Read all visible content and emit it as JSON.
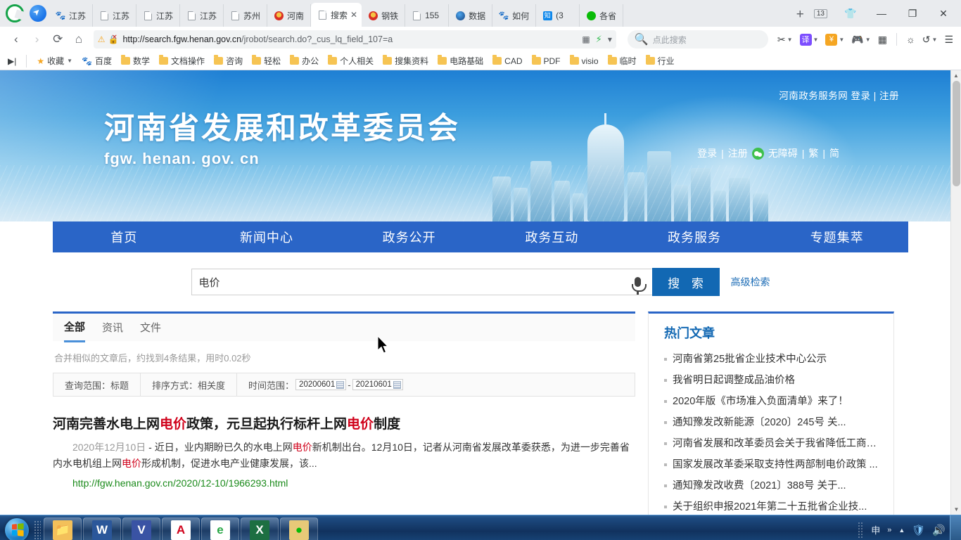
{
  "browser": {
    "tabs": [
      {
        "title": "江苏",
        "favicon": "baidu-icon",
        "active": false
      },
      {
        "title": "江苏",
        "favicon": "document-icon",
        "active": false
      },
      {
        "title": "江苏",
        "favicon": "document-icon",
        "active": false
      },
      {
        "title": "江苏",
        "favicon": "document-icon",
        "active": false
      },
      {
        "title": "苏州",
        "favicon": "document-icon",
        "active": false
      },
      {
        "title": "河南",
        "favicon": "gov-emblem-icon",
        "active": false
      },
      {
        "title": "搜索",
        "favicon": "document-icon",
        "active": true
      },
      {
        "title": "钢铁",
        "favicon": "gov-emblem-icon",
        "active": false
      },
      {
        "title": "155",
        "favicon": "document-icon",
        "active": false
      },
      {
        "title": "数据",
        "favicon": "globe-icon",
        "active": false
      },
      {
        "title": "如何",
        "favicon": "baidu-icon",
        "active": false
      },
      {
        "title": "(3 ",
        "favicon": "zhihu-icon",
        "active": false
      },
      {
        "title": "各省",
        "favicon": "wechat-icon",
        "active": false
      }
    ],
    "new_tab_label": "+",
    "window_badge": "13",
    "window_controls": {
      "minimize": "—",
      "maximize": "❐",
      "close": "✕"
    },
    "address": {
      "url_bold": "http://search.fgw.henan.gov.cn",
      "url_dim": "/jrobot/search.do?_cus_lq_field_107=a",
      "shield_icon": "warning-shield-icon",
      "lock_icon": "broken-lock-icon"
    },
    "toolbar_search_placeholder": "点此搜索",
    "nav": {
      "back": "‹",
      "forward": "›",
      "reload": "⟳",
      "home": "⌂"
    },
    "tools": [
      {
        "name": "screenshot-tool",
        "glyph": "✂",
        "color": "#3c4043"
      },
      {
        "name": "translate-tool",
        "glyph": "译",
        "color": "#7c4dff"
      },
      {
        "name": "coupon-tool",
        "glyph": "¥",
        "color": "#f5a623"
      },
      {
        "name": "game-tool",
        "glyph": "🎮",
        "color": "#ff5a36"
      },
      {
        "name": "apps-grid",
        "glyph": "▦",
        "color": "#3c4043"
      },
      {
        "name": "theme-tool",
        "glyph": "☼",
        "color": "#3c4043"
      },
      {
        "name": "history-tool",
        "glyph": "↺",
        "color": "#3c4043"
      },
      {
        "name": "menu-tool",
        "glyph": "☰",
        "color": "#3c4043"
      }
    ],
    "bookmarks": {
      "favorites_label": "收藏",
      "items": [
        {
          "label": "百度",
          "icon": "baidu-icon"
        },
        {
          "label": "数学",
          "icon": "folder-icon"
        },
        {
          "label": "文档操作",
          "icon": "folder-icon"
        },
        {
          "label": "咨询",
          "icon": "folder-icon"
        },
        {
          "label": "轻松",
          "icon": "folder-icon"
        },
        {
          "label": "办公",
          "icon": "folder-icon"
        },
        {
          "label": "个人相关",
          "icon": "folder-icon"
        },
        {
          "label": "搜集资料",
          "icon": "folder-icon"
        },
        {
          "label": "电路基础",
          "icon": "folder-icon"
        },
        {
          "label": "CAD",
          "icon": "folder-icon"
        },
        {
          "label": "PDF",
          "icon": "folder-icon"
        },
        {
          "label": "visio",
          "icon": "folder-icon"
        },
        {
          "label": "临时",
          "icon": "folder-icon"
        },
        {
          "label": "行业",
          "icon": "folder-icon"
        }
      ]
    }
  },
  "site": {
    "top_link": "河南政务服务网 登录 | 注册",
    "title": "河南省发展和改革委员会",
    "subtitle": "fgw. henan. gov. cn",
    "utility": {
      "login": "登录",
      "sep1": "|",
      "register": "注册",
      "wechat_icon": "wechat-icon",
      "accessibility": "无障碍",
      "sep2": "|",
      "traditional": "繁",
      "sep3": "|",
      "simplified": "简"
    },
    "nav_items": [
      "首页",
      "新闻中心",
      "政务公开",
      "政务互动",
      "政务服务",
      "专题集萃"
    ],
    "search": {
      "value": "电价",
      "mic_icon": "microphone-icon",
      "button_label": "搜 索",
      "advanced_label": "高级检索"
    },
    "result_tabs": [
      {
        "label": "全部",
        "active": true
      },
      {
        "label": "资讯",
        "active": false
      },
      {
        "label": "文件",
        "active": false
      }
    ],
    "result_info": "合并相似的文章后，约找到4条结果，用时0.02秒",
    "filters": {
      "scope_label": "查询范围：标题",
      "sort_label": "排序方式：相关度",
      "time_label": "时间范围：",
      "date_from": "20200601",
      "date_to": "20210601",
      "date_sep": "-"
    },
    "results": [
      {
        "title_parts": [
          {
            "t": "河南完善水电上网",
            "hl": false
          },
          {
            "t": "电价",
            "hl": true
          },
          {
            "t": "政策，元旦起执行标杆上网",
            "hl": false
          },
          {
            "t": "电价",
            "hl": true
          },
          {
            "t": "制度",
            "hl": false
          }
        ],
        "date": "2020年12月10日",
        "snippet_parts": [
          {
            "t": " - 近日，业内期盼已久的水电上网",
            "hl": false
          },
          {
            "t": "电价",
            "hl": true
          },
          {
            "t": "新机制出台。12月10日，记者从河南省发展改革委获悉，为进一步完善省内水电机组上网",
            "hl": false
          },
          {
            "t": "电价",
            "hl": true
          },
          {
            "t": "形成机制，促进水电产业健康发展，该...",
            "hl": false
          }
        ],
        "url": "http://fgw.henan.gov.cn/2020/12-10/1966293.html"
      }
    ],
    "hot": {
      "title": "热门文章",
      "items": [
        "河南省第25批省企业技术中心公示",
        "我省明日起调整成品油价格",
        "2020年版《市场准入负面清单》来了！",
        "通知豫发改新能源〔2020〕245号 关...",
        "河南省发展和改革委员会关于我省降低工商业...",
        "国家发展改革委采取支持性两部制电价政策 ...",
        "通知豫发改收费〔2021〕388号 关于...",
        "关于组织申报2021年第二十五批省企业技..."
      ]
    }
  },
  "taskbar": {
    "start_label": "start-orb",
    "apps": [
      {
        "name": "file-explorer",
        "glyph": "📁",
        "bg": "#f3c05a",
        "fg": "#7a5200"
      },
      {
        "name": "word",
        "glyph": "W",
        "bg": "#2b579a",
        "fg": "#ffffff"
      },
      {
        "name": "visio",
        "glyph": "V",
        "bg": "#3a53a4",
        "fg": "#ffffff"
      },
      {
        "name": "acrobat-reader",
        "glyph": "A",
        "bg": "#ffffff",
        "fg": "#d0021b"
      },
      {
        "name": "browser",
        "glyph": "e",
        "bg": "#ffffff",
        "fg": "#28a745"
      },
      {
        "name": "excel",
        "glyph": "X",
        "bg": "#1d6f42",
        "fg": "#ffffff"
      },
      {
        "name": "wechat",
        "glyph": "●",
        "bg": "#e8c978",
        "fg": "#09bb07"
      }
    ],
    "tray": {
      "ime": "申",
      "overflow": "»",
      "arrow": "▲",
      "security_icon": "shield-icon",
      "volume_icon": "speaker-icon"
    }
  }
}
